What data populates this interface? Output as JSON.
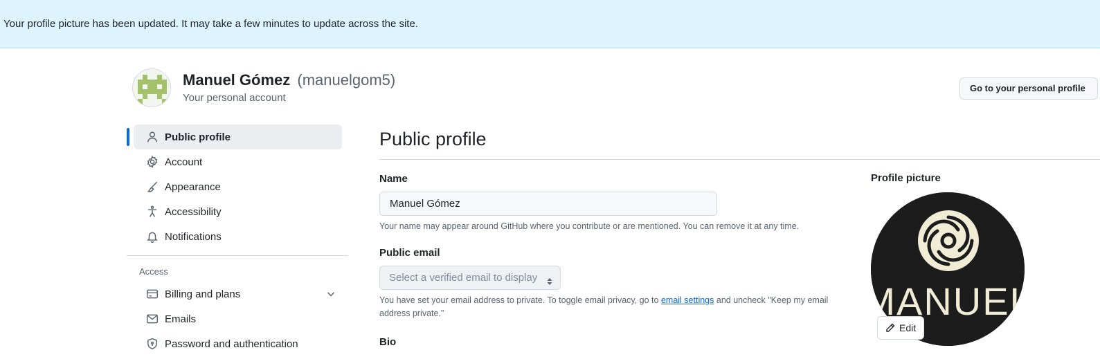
{
  "flash": {
    "message": "Your profile picture has been updated. It may take a few minutes to update across the site."
  },
  "header": {
    "name": "Manuel Gómez",
    "login": "(manuelgom5)",
    "subtitle": "Your personal account",
    "goto_button": "Go to your personal profile"
  },
  "sidebar": {
    "items": [
      {
        "label": "Public profile",
        "icon": "person-icon",
        "active": true
      },
      {
        "label": "Account",
        "icon": "gear-icon"
      },
      {
        "label": "Appearance",
        "icon": "paintbrush-icon"
      },
      {
        "label": "Accessibility",
        "icon": "accessibility-icon"
      },
      {
        "label": "Notifications",
        "icon": "bell-icon"
      }
    ],
    "section_access": "Access",
    "access_items": [
      {
        "label": "Billing and plans",
        "icon": "credit-card-icon",
        "expandable": true
      },
      {
        "label": "Emails",
        "icon": "mail-icon"
      },
      {
        "label": "Password and authentication",
        "icon": "shield-lock-icon"
      }
    ]
  },
  "main": {
    "title": "Public profile",
    "name_label": "Name",
    "name_value": "Manuel Gómez",
    "name_hint": "Your name may appear around GitHub where you contribute or are mentioned. You can remove it at any time.",
    "email_label": "Public email",
    "email_select_value": "Select a verified email to display",
    "email_hint_before": "You have set your email address to private. To toggle email privacy, go to ",
    "email_hint_link": "email settings",
    "email_hint_after": " and uncheck \"Keep my email address private.\"",
    "bio_label": "Bio"
  },
  "profile_picture": {
    "label": "Profile picture",
    "image_text": "MANUEL",
    "edit_button": "Edit"
  },
  "colors": {
    "flash_bg": "#ddf4ff",
    "accent": "#0969da",
    "avatar_green": "#a3c26a",
    "picture_bg": "#1c1c1c",
    "picture_fg": "#f1ecd6"
  }
}
